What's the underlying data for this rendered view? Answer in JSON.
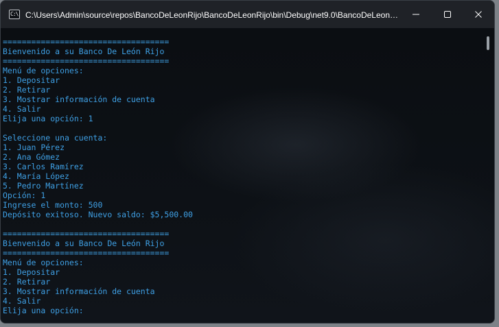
{
  "window": {
    "title": "C:\\Users\\Admin\\source\\repos\\BancoDeLeonRijo\\BancoDeLeonRijo\\bin\\Debug\\net9.0\\BancoDeLeonRij..."
  },
  "icons": {
    "app": "console-app-icon",
    "minimize": "minimize-icon",
    "maximize": "maximize-icon",
    "close": "close-icon"
  },
  "app_icon_text": "C:\\",
  "colors": {
    "console_text": "#3fa1e6",
    "titlebar": "#1f2227",
    "console_bg": "#0c0f13"
  },
  "console": {
    "lines": [
      "===================================",
      "Bienvenido a su Banco De León Rijo",
      "===================================",
      "Menú de opciones:",
      "1. Depositar",
      "2. Retirar",
      "3. Mostrar información de cuenta",
      "4. Salir",
      "Elija una opción: 1",
      "",
      "Seleccione una cuenta:",
      "1. Juan Pérez",
      "2. Ana Gómez",
      "3. Carlos Ramírez",
      "4. María López",
      "5. Pedro Martínez",
      "Opción: 1",
      "Ingrese el monto: 500",
      "Depósito exitoso. Nuevo saldo: $5,500.00",
      "",
      "===================================",
      "Bienvenido a su Banco De León Rijo",
      "===================================",
      "Menú de opciones:",
      "1. Depositar",
      "2. Retirar",
      "3. Mostrar información de cuenta",
      "4. Salir",
      "Elija una opción:"
    ]
  }
}
